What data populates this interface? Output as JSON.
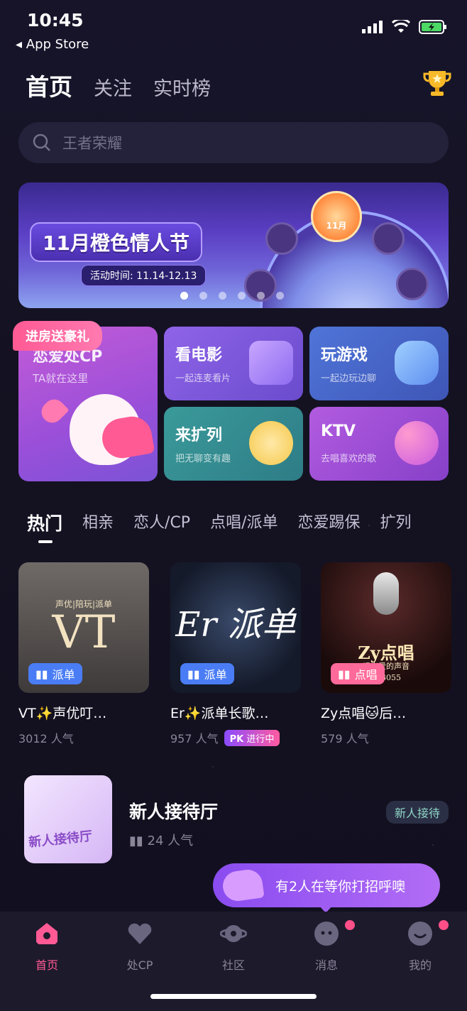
{
  "status_bar": {
    "time": "10:45",
    "back_label": "App Store"
  },
  "top_tabs": [
    {
      "label": "首页",
      "active": true
    },
    {
      "label": "关注",
      "active": false
    },
    {
      "label": "实时榜",
      "active": false
    }
  ],
  "search": {
    "placeholder": "王者荣耀"
  },
  "banner": {
    "title": "11月橙色情人节",
    "date": "活动时间: 11.14-12.13",
    "medal_label": "11月",
    "dots_count": 6,
    "active_dot": 0
  },
  "feature_cards": {
    "cp": {
      "ribbon": "进房送豪礼",
      "title": "恋爱处CP",
      "subtitle": "TA就在这里"
    },
    "movie": {
      "title": "看电影",
      "subtitle": "一起连麦看片"
    },
    "game": {
      "title": "玩游戏",
      "subtitle": "一起边玩边聊"
    },
    "party": {
      "title": "来扩列",
      "subtitle": "把无聊变有趣"
    },
    "ktv": {
      "title": "KTV",
      "subtitle": "去唱喜欢的歌"
    }
  },
  "category_tabs": [
    {
      "label": "热门",
      "active": true
    },
    {
      "label": "相亲"
    },
    {
      "label": "恋人/CP"
    },
    {
      "label": "点唱/派单"
    },
    {
      "label": "恋爱踢保"
    },
    {
      "label": "扩列"
    }
  ],
  "rooms": [
    {
      "name": "VT✨声优叮…",
      "popularity": "3012 人气",
      "tag": "派单",
      "thumb_text": "VT",
      "thumb_sub": "声优|陪玩|派单"
    },
    {
      "name": "Er✨派单长歌…",
      "popularity": "957 人气",
      "tag": "派单",
      "thumb_text": "Er 派单",
      "pk": "进行中",
      "pk_label": "PK"
    },
    {
      "name": "Zy点唱🐱后…",
      "popularity": "579 人气",
      "tag": "点唱",
      "thumb_text": "Zy点唱",
      "thumb_sub": "唱出爱的声音",
      "thumb_id": "233055"
    }
  ],
  "list_room": {
    "title": "新人接待厅",
    "popularity": "24 人气",
    "badge": "新人接待",
    "avatar_text": "新人接待厅"
  },
  "bubble": {
    "text": "有2人在等你打招呼噢"
  },
  "bottom_nav": [
    {
      "label": "首页",
      "icon": "home-icon",
      "active": true
    },
    {
      "label": "处CP",
      "icon": "heart-icon",
      "active": false
    },
    {
      "label": "社区",
      "icon": "planet-icon",
      "active": false
    },
    {
      "label": "消息",
      "icon": "message-icon",
      "active": false,
      "dot": true
    },
    {
      "label": "我的",
      "icon": "profile-icon",
      "active": false,
      "dot": true
    }
  ],
  "colors": {
    "accent": "#ff5a94",
    "background": "#14121f",
    "purple": "#8a4cf0"
  }
}
